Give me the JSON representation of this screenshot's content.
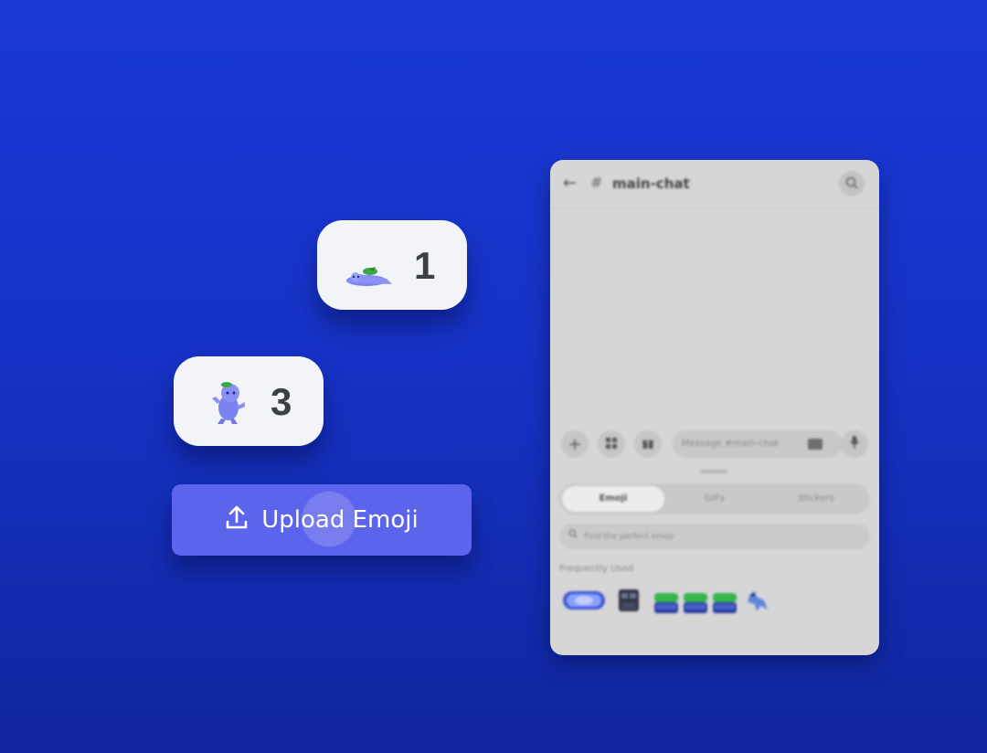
{
  "reactions": [
    {
      "count": "1",
      "emoji": "wumpus-lying-emoji"
    },
    {
      "count": "3",
      "emoji": "wumpus-dancing-emoji"
    }
  ],
  "upload_button": {
    "label": "Upload Emoji",
    "icon": "upload-icon"
  },
  "phone": {
    "header": {
      "channel": "main-chat"
    },
    "composer": {
      "placeholder": "Message #main-chat"
    },
    "picker": {
      "tabs": [
        {
          "label": "Emoji",
          "active": true
        },
        {
          "label": "GIFs",
          "active": false
        },
        {
          "label": "Stickers",
          "active": false
        }
      ],
      "search_placeholder": "Find the perfect emoji",
      "section_label": "Frequently Used"
    }
  },
  "colors": {
    "background_top": "#1a3ad8",
    "background_bottom": "#10269e",
    "button": "#5d64ec",
    "chip": "#f3f4f8",
    "phone": "#d6d6d7"
  }
}
